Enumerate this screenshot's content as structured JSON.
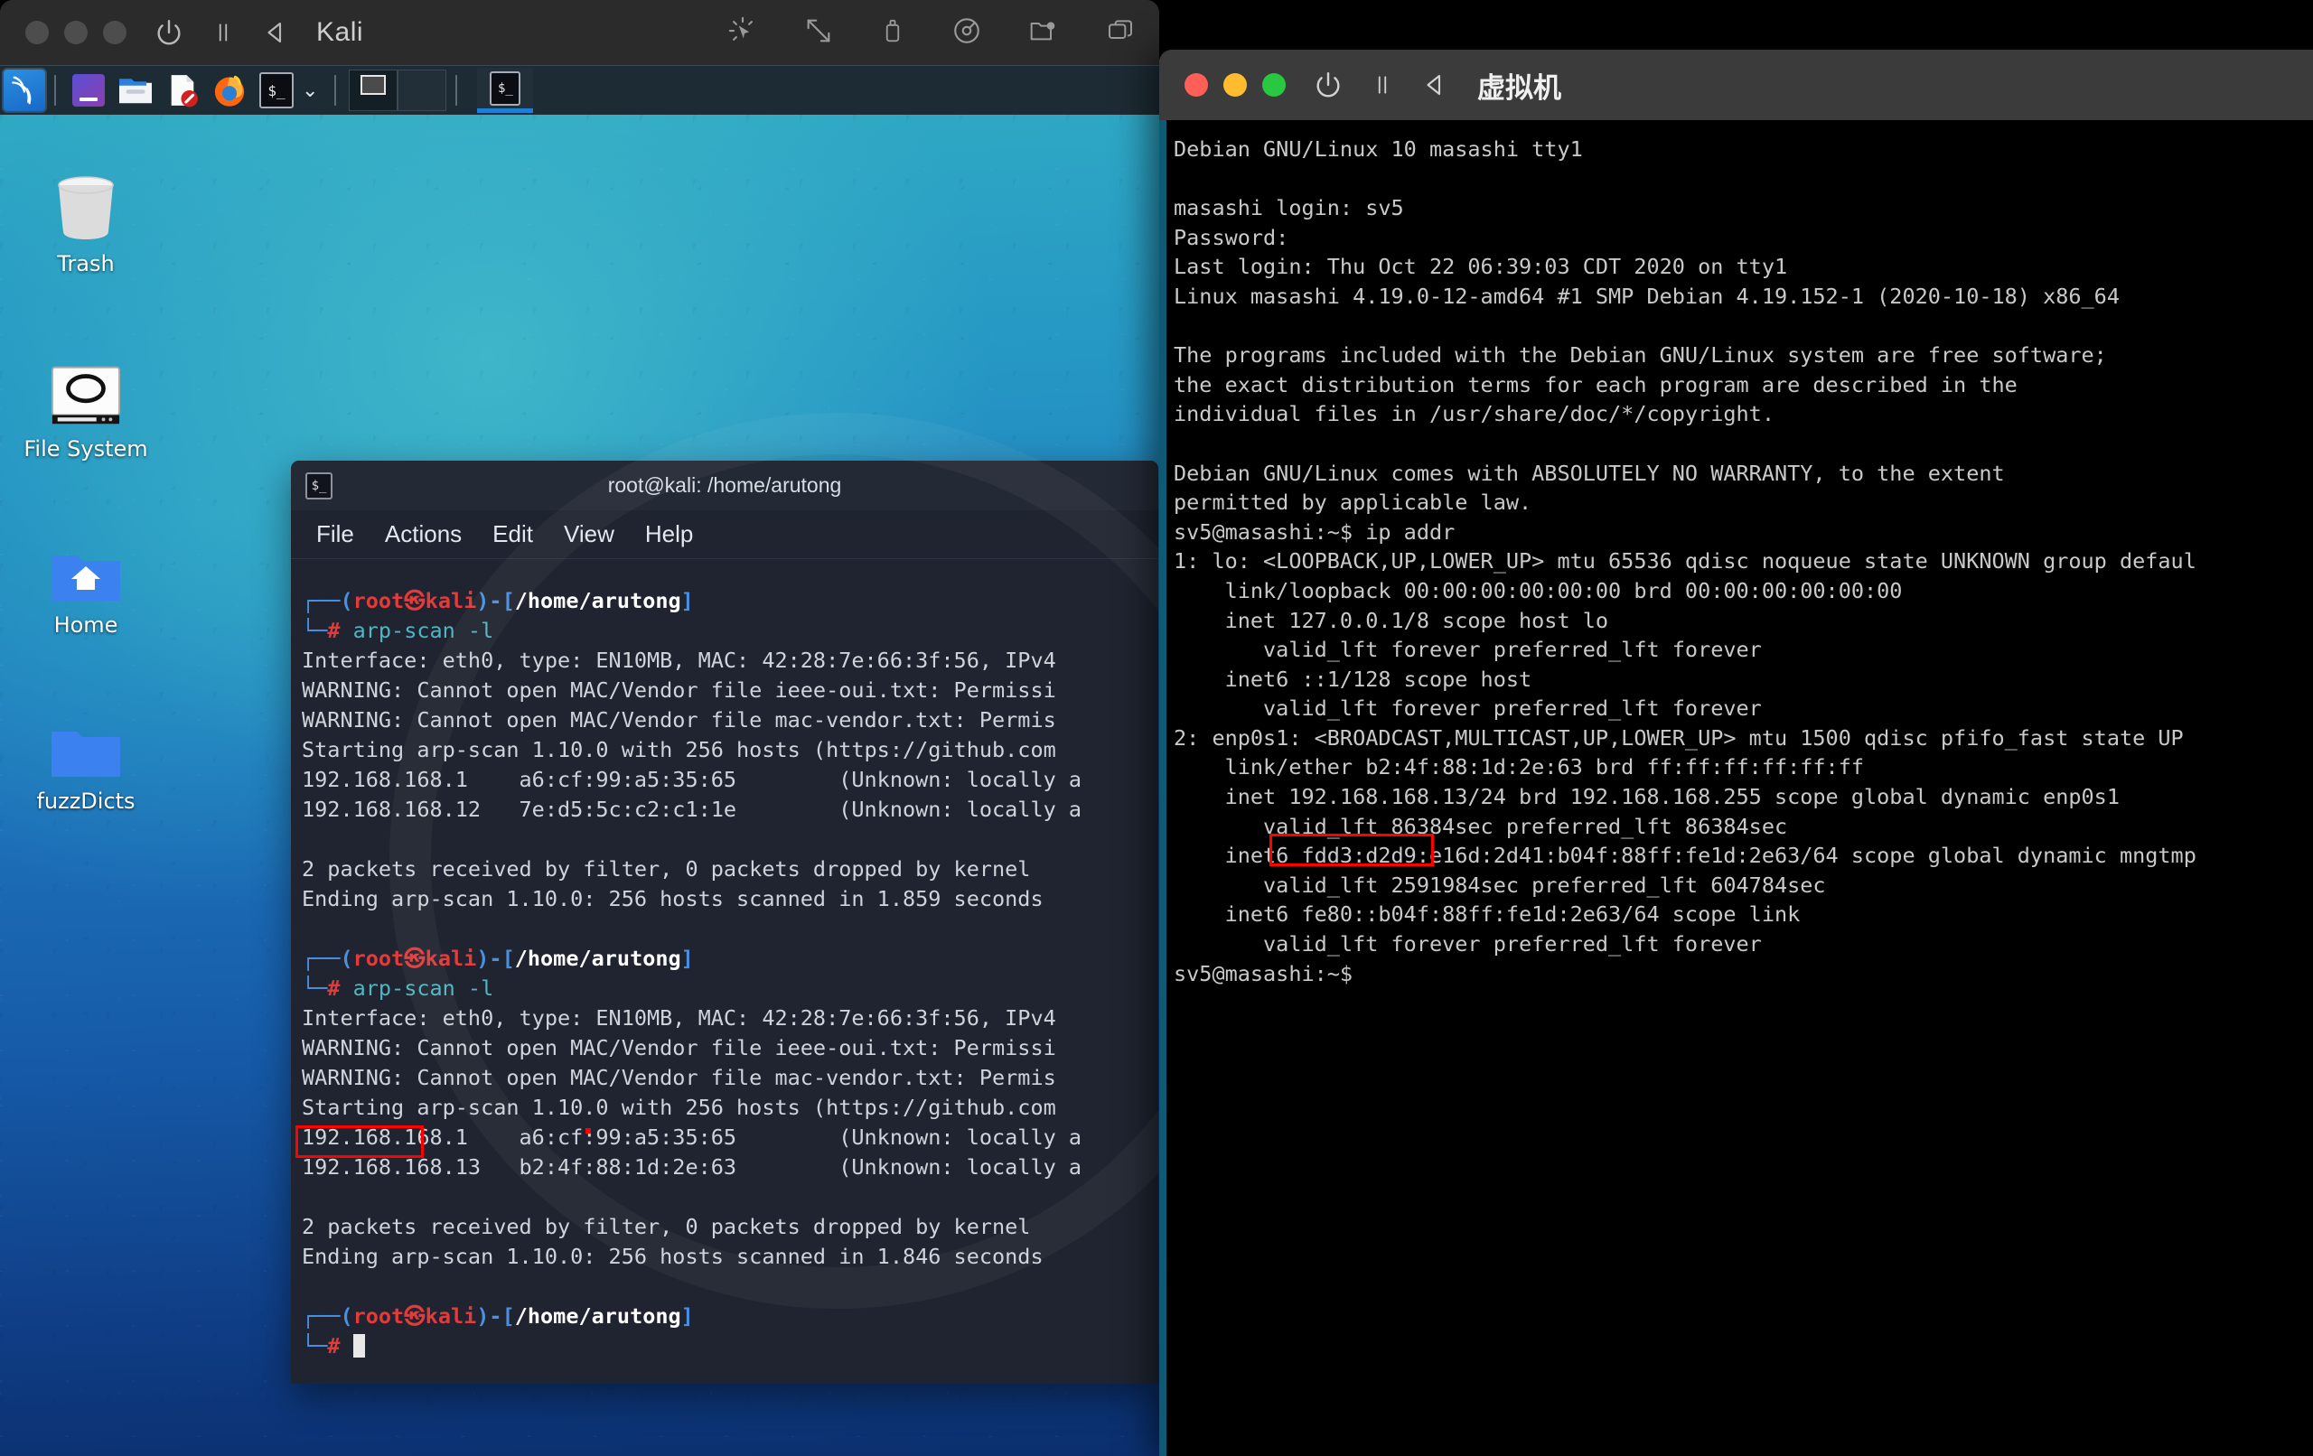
{
  "host_window": {
    "title": "Kali",
    "traffic_lights": [
      "grey",
      "grey",
      "grey"
    ],
    "icons": [
      "power-icon",
      "pause-icon",
      "back-icon"
    ],
    "right_icons": [
      "pointer-icon",
      "resize-icon",
      "usb-icon",
      "disc-icon",
      "shared-folder-icon",
      "windows-icon"
    ]
  },
  "kali_panel": {
    "launcher": "kali-dragon-icon",
    "items": [
      {
        "name": "app-finder-icon",
        "label": "Application Finder"
      },
      {
        "name": "file-manager-icon",
        "label": "File Manager"
      },
      {
        "name": "text-editor-icon",
        "label": "Text Editor"
      },
      {
        "name": "firefox-icon",
        "label": "Firefox ESR"
      },
      {
        "name": "terminal-icon",
        "label": "Terminal Emulator"
      }
    ],
    "caret": "chevron-down-icon",
    "workspaces": [
      "1",
      "2"
    ],
    "taskbar_items": [
      {
        "name": "taskbar-terminal",
        "label": "root@kali: /home/arutong"
      }
    ]
  },
  "desktop": {
    "icons": [
      {
        "name": "trash",
        "label": "Trash",
        "glyph": "trash-icon"
      },
      {
        "name": "file-system",
        "label": "File System",
        "glyph": "drive-icon"
      },
      {
        "name": "home",
        "label": "Home",
        "glyph": "home-folder-icon"
      },
      {
        "name": "fuzzdicts",
        "label": "fuzzDicts",
        "glyph": "folder-icon"
      }
    ]
  },
  "terminal_window": {
    "title": "root@kali: /home/arutong",
    "icon": "terminal-icon",
    "menu": [
      "File",
      "Actions",
      "Edit",
      "View",
      "Help"
    ],
    "prompt": {
      "user": "root",
      "at": "@",
      "host": "kali",
      "path": "/home/arutong",
      "sigil": "#"
    },
    "lines": [
      {
        "type": "prompt"
      },
      {
        "type": "cmd",
        "text": "arp-scan -l"
      },
      {
        "type": "out",
        "text": "Interface: eth0, type: EN10MB, MAC: 42:28:7e:66:3f:56, IPv4"
      },
      {
        "type": "out",
        "text": "WARNING: Cannot open MAC/Vendor file ieee-oui.txt: Permissi"
      },
      {
        "type": "out",
        "text": "WARNING: Cannot open MAC/Vendor file mac-vendor.txt: Permis"
      },
      {
        "type": "out",
        "text": "Starting arp-scan 1.10.0 with 256 hosts (https://github.com"
      },
      {
        "type": "out",
        "text": "192.168.168.1    a6:cf:99:a5:35:65        (Unknown: locally a"
      },
      {
        "type": "out",
        "text": "192.168.168.12   7e:d5:5c:c2:c1:1e        (Unknown: locally a"
      },
      {
        "type": "blank"
      },
      {
        "type": "out",
        "text": "2 packets received by filter, 0 packets dropped by kernel"
      },
      {
        "type": "out",
        "text": "Ending arp-scan 1.10.0: 256 hosts scanned in 1.859 seconds"
      },
      {
        "type": "blank"
      },
      {
        "type": "prompt"
      },
      {
        "type": "cmd",
        "text": "arp-scan -l"
      },
      {
        "type": "out",
        "text": "Interface: eth0, type: EN10MB, MAC: 42:28:7e:66:3f:56, IPv4"
      },
      {
        "type": "out",
        "text": "WARNING: Cannot open MAC/Vendor file ieee-oui.txt: Permissi"
      },
      {
        "type": "out",
        "text": "WARNING: Cannot open MAC/Vendor file mac-vendor.txt: Permis"
      },
      {
        "type": "out",
        "text": "Starting arp-scan 1.10.0 with 256 hosts (https://github.com"
      },
      {
        "type": "out",
        "text": "192.168.168.1    a6:cf:99:a5:35:65        (Unknown: locally a"
      },
      {
        "type": "out",
        "text": "192.168.168.13   b2:4f:88:1d:2e:63        (Unknown: locally a"
      },
      {
        "type": "blank"
      },
      {
        "type": "out",
        "text": "2 packets received by filter, 0 packets dropped by kernel"
      },
      {
        "type": "out",
        "text": "Ending arp-scan 1.10.0: 256 hosts scanned in 1.846 seconds"
      },
      {
        "type": "blank"
      },
      {
        "type": "prompt"
      },
      {
        "type": "cursor"
      }
    ],
    "highlight": {
      "label": "192.168.168.13",
      "color": "#ff0000"
    }
  },
  "vm_window": {
    "title": "虚拟机",
    "traffic_lights": [
      "red",
      "yellow",
      "green"
    ],
    "icons": [
      "power-icon",
      "pause-icon",
      "back-icon"
    ],
    "console_lines": [
      "Debian GNU/Linux 10 masashi tty1",
      "",
      "masashi login: sv5",
      "Password:",
      "Last login: Thu Oct 22 06:39:03 CDT 2020 on tty1",
      "Linux masashi 4.19.0-12-amd64 #1 SMP Debian 4.19.152-1 (2020-10-18) x86_64",
      "",
      "The programs included with the Debian GNU/Linux system are free software;",
      "the exact distribution terms for each program are described in the",
      "individual files in /usr/share/doc/*/copyright.",
      "",
      "Debian GNU/Linux comes with ABSOLUTELY NO WARRANTY, to the extent",
      "permitted by applicable law.",
      "sv5@masashi:~$ ip addr",
      "1: lo: <LOOPBACK,UP,LOWER_UP> mtu 65536 qdisc noqueue state UNKNOWN group defaul",
      "    link/loopback 00:00:00:00:00:00 brd 00:00:00:00:00:00",
      "    inet 127.0.0.1/8 scope host lo",
      "       valid_lft forever preferred_lft forever",
      "    inet6 ::1/128 scope host",
      "       valid_lft forever preferred_lft forever",
      "2: enp0s1: <BROADCAST,MULTICAST,UP,LOWER_UP> mtu 1500 qdisc pfifo_fast state UP",
      "    link/ether b2:4f:88:1d:2e:63 brd ff:ff:ff:ff:ff:ff",
      "    inet 192.168.168.13/24 brd 192.168.168.255 scope global dynamic enp0s1",
      "       valid_lft 86384sec preferred_lft 86384sec",
      "    inet6 fdd3:d2d9:e16d:2d41:b04f:88ff:fe1d:2e63/64 scope global dynamic mngtmp",
      "       valid_lft 2591984sec preferred_lft 604784sec",
      "    inet6 fe80::b04f:88ff:fe1d:2e63/64 scope link",
      "       valid_lft forever preferred_lft forever",
      "sv5@masashi:~$ "
    ],
    "highlight": {
      "label": "192.168.168.13/24",
      "color": "#ff0000"
    },
    "cursor": "mouse-pointer"
  }
}
